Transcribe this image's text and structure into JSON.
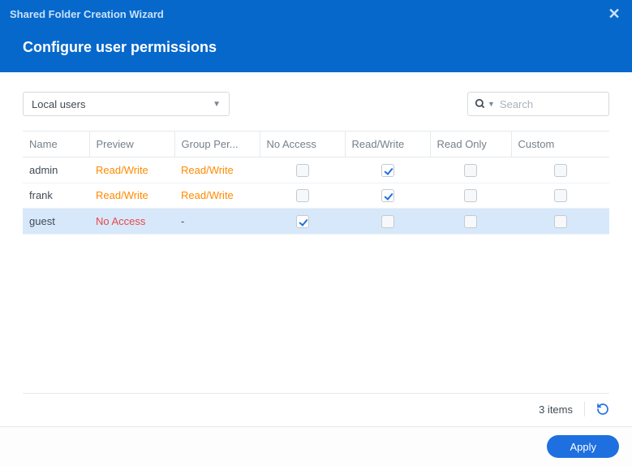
{
  "window": {
    "title": "Shared Folder Creation Wizard",
    "page_title": "Configure user permissions"
  },
  "toolbar": {
    "scope_label": "Local users",
    "search_placeholder": "Search"
  },
  "table": {
    "headers": {
      "name": "Name",
      "preview": "Preview",
      "group": "Group Per...",
      "no_access": "No Access",
      "read_write": "Read/Write",
      "read_only": "Read Only",
      "custom": "Custom"
    },
    "rows": [
      {
        "name": "admin",
        "preview": "Read/Write",
        "preview_class": "rw-text",
        "group": "Read/Write",
        "group_class": "rw-text",
        "no_access": false,
        "read_write": true,
        "read_only": false,
        "custom": false,
        "selected": false
      },
      {
        "name": "frank",
        "preview": "Read/Write",
        "preview_class": "rw-text",
        "group": "Read/Write",
        "group_class": "rw-text",
        "no_access": false,
        "read_write": true,
        "read_only": false,
        "custom": false,
        "selected": false
      },
      {
        "name": "guest",
        "preview": "No Access",
        "preview_class": "na-text",
        "group": "-",
        "group_class": "",
        "no_access": true,
        "read_write": false,
        "read_only": false,
        "custom": false,
        "selected": true
      }
    ]
  },
  "footer": {
    "count_label": "3 items",
    "apply_label": "Apply"
  }
}
